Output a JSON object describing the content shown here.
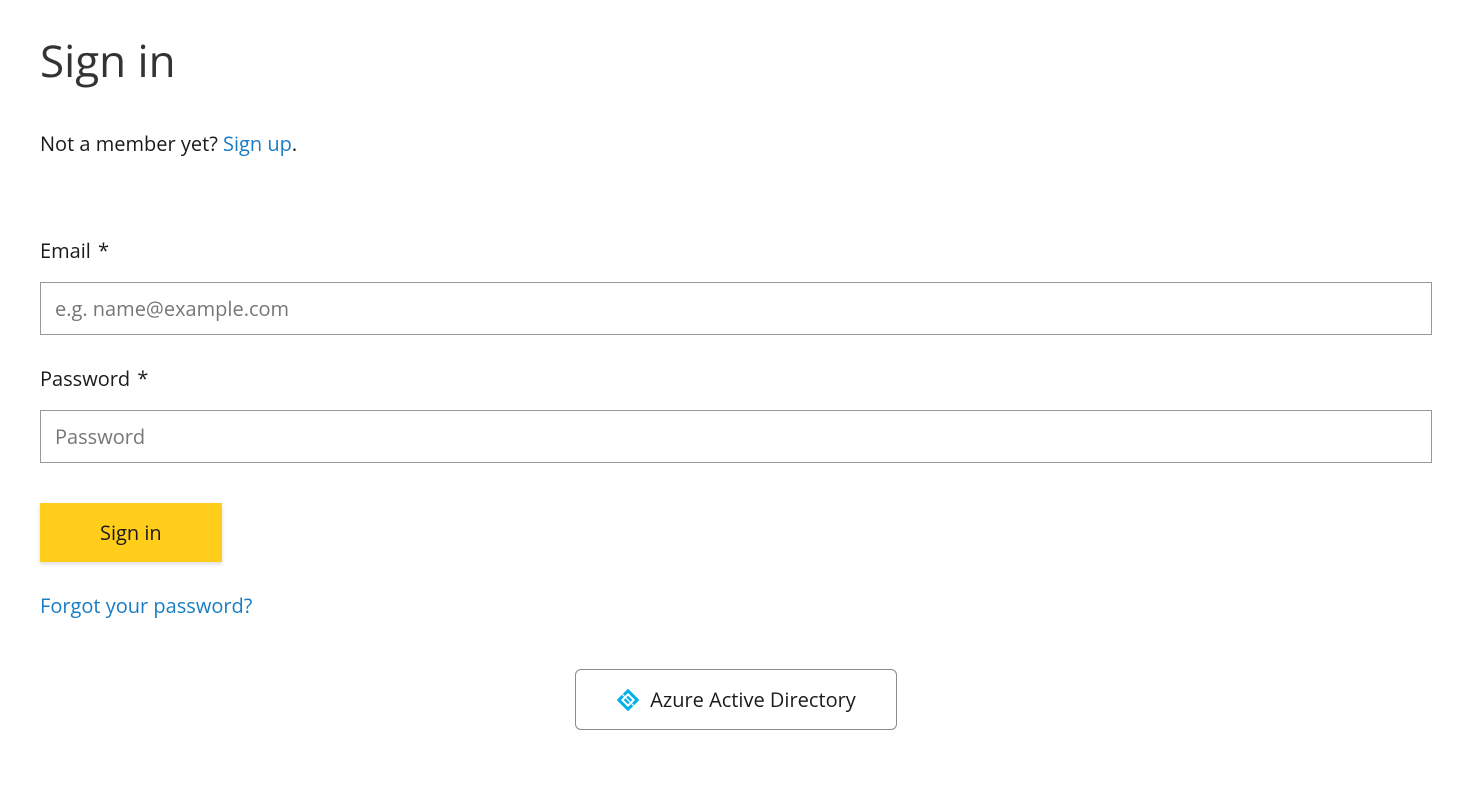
{
  "page": {
    "title": "Sign in"
  },
  "signup_prompt": {
    "text": "Not a member yet? ",
    "link_text": "Sign up",
    "suffix": "."
  },
  "form": {
    "email": {
      "label": "Email",
      "required_marker": "*",
      "placeholder": "e.g. name@example.com",
      "value": ""
    },
    "password": {
      "label": "Password",
      "required_marker": "*",
      "placeholder": "Password",
      "value": ""
    },
    "submit_label": "Sign in"
  },
  "forgot_password": {
    "text": "Forgot your password?"
  },
  "sso": {
    "azure_label": "Azure Active Directory"
  }
}
